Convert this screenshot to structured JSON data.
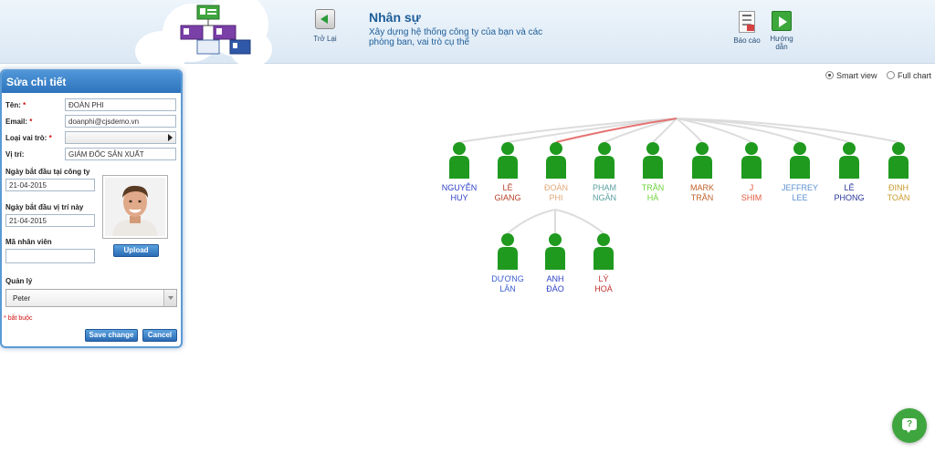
{
  "header": {
    "back_label": "Trở Lại",
    "title": "Nhân sự",
    "description": "Xây dựng hệ thống công ty của bạn và các phòng ban, vai trò cụ thể",
    "report_label": "Báo cáo",
    "guide_label": "Hướng dẫn"
  },
  "view_options": {
    "smart_view": "Smart view",
    "full_chart": "Full chart",
    "selected": "smart_view"
  },
  "edit_panel": {
    "title": "Sửa chi tiết",
    "name_label": "Tên:",
    "name_value": "ĐOÀN PHI",
    "email_label": "Email:",
    "email_value": "doanphi@cjsdemo.vn",
    "role_label": "Loại vai trò:",
    "role_value": "",
    "position_label": "Vị trí:",
    "position_value": "GIÁM ĐỐC SẢN XUẤT",
    "company_start_label": "Ngày bắt đầu tại công ty",
    "company_start_value": "21-04-2015",
    "position_start_label": "Ngày bắt đầu vị trí này",
    "position_start_value": "21-04-2015",
    "employee_id_label": "Mã nhân viên",
    "employee_id_value": "",
    "upload_label": "Upload",
    "manager_label": "Quản lý",
    "manager_value": "Peter",
    "required_note": "bắt buộc",
    "save_label": "Save change",
    "cancel_label": "Cancel",
    "required_mark": "*"
  },
  "org_chart": {
    "top_level": [
      {
        "first": "NGUYỄN",
        "last": "HUY",
        "color": "#2d3fc6"
      },
      {
        "first": "LÊ",
        "last": "GIANG",
        "color": "#b8402a"
      },
      {
        "first": "ĐOÀN",
        "last": "PHI",
        "color": "#e0a878",
        "selected": true
      },
      {
        "first": "PHẠM",
        "last": "NGÂN",
        "color": "#5a9fa0"
      },
      {
        "first": "TRẦN",
        "last": "HÀ",
        "color": "#6cd43a"
      },
      {
        "first": "MARK",
        "last": "TRẦN",
        "color": "#c0622c"
      },
      {
        "first": "J",
        "last": "SHIM",
        "color": "#e2573c"
      },
      {
        "first": "JEFFREY",
        "last": "LEE",
        "color": "#5b8fcf"
      },
      {
        "first": "LÊ",
        "last": "PHONG",
        "color": "#26339a"
      },
      {
        "first": "ĐINH",
        "last": "TOÀN",
        "color": "#c79a2c"
      }
    ],
    "children_of_selected": [
      {
        "first": "DƯƠNG",
        "last": "LÂN",
        "color": "#3b5fd0"
      },
      {
        "first": "ANH",
        "last": "ĐÀO",
        "color": "#2d3fc6"
      },
      {
        "first": "LÝ",
        "last": "HOÀ",
        "color": "#c0302a"
      }
    ]
  },
  "help": {
    "icon": "question-chat-icon",
    "glyph": "?"
  },
  "colors": {
    "accent": "#2e74bd",
    "person": "#1f9a1f",
    "highlight_link": "#e57373",
    "help": "#3fa63f"
  }
}
